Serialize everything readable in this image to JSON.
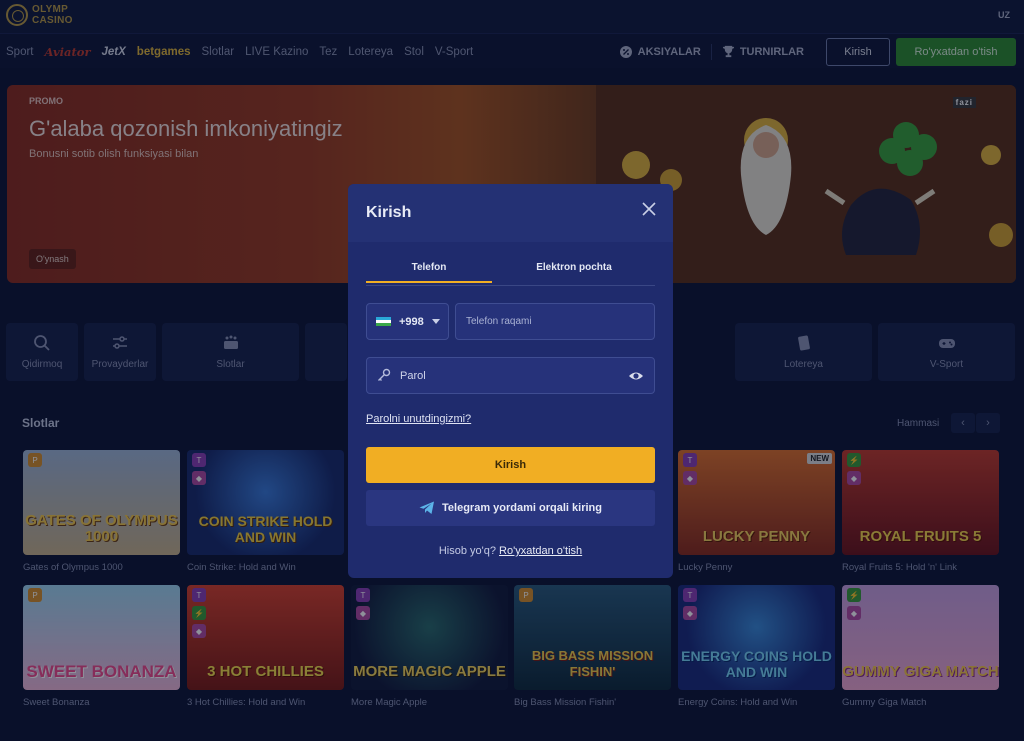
{
  "header": {
    "logo_line1": "OLYMP",
    "logo_line2": "CASINO",
    "lang": "UZ"
  },
  "nav": {
    "links": [
      "Sport",
      "Aviator",
      "JetX",
      "betgames",
      "Slotlar",
      "LIVE Kazino",
      "Tez",
      "Lotereya",
      "Stol",
      "V-Sport"
    ],
    "promotions": "AKSIYALAR",
    "tournaments": "TURNIRLAR",
    "login": "Kirish",
    "register": "Ro'yxatdan o'tish"
  },
  "banner": {
    "tag": "PROMO",
    "title": "G'alaba qozonish imkoniyatingiz",
    "subtitle": "Bonusni sotib olish funksiyasi bilan",
    "cta": "O'ynash",
    "provider": "fazi"
  },
  "categories": [
    "Qidirmoq",
    "Provayderlar",
    "Slotlar",
    "Lotereya",
    "V-Sport"
  ],
  "slots": {
    "title": "Slotlar",
    "all": "Hammasi",
    "games_row1": [
      {
        "name": "Gates of Olympus 1000",
        "art": "GATES OF OLYMPUS 1000"
      },
      {
        "name": "Coin Strike: Hold and Win",
        "art": "COIN STRIKE HOLD AND WIN"
      },
      {
        "name": "Lucky Penny",
        "art": "LUCKY PENNY"
      },
      {
        "name": "Royal Fruits 5: Hold 'n' Link",
        "art": "ROYAL FRUITS 5"
      }
    ],
    "games_row2": [
      {
        "name": "Sweet Bonanza",
        "art": "SWEET BONANZA"
      },
      {
        "name": "3 Hot Chillies: Hold and Win",
        "art": "3 HOT CHILLIES"
      },
      {
        "name": "More Magic Apple",
        "art": "MORE MAGIC APPLE"
      },
      {
        "name": "Big Bass Mission Fishin'",
        "art": "BIG BASS MISSION FISHIN'"
      },
      {
        "name": "Energy Coins: Hold and Win",
        "art": "ENERGY COINS HOLD AND WIN"
      },
      {
        "name": "Gummy Giga Match",
        "art": "GUMMY GIGA MATCH"
      }
    ],
    "new_badge": "NEW"
  },
  "modal": {
    "title": "Kirish",
    "tab_phone": "Telefon",
    "tab_email": "Elektron pochta",
    "country_code": "+998",
    "phone_placeholder": "Telefon raqami",
    "password_placeholder": "Parol",
    "forgot": "Parolni unutdingizmi?",
    "submit": "Kirish",
    "telegram": "Telegram yordami orqali kiring",
    "no_account": "Hisob yo'q?",
    "register_link": "Ro'yxatdan o'tish"
  },
  "colors": {
    "accent": "#f1ae23",
    "register": "#2f8a2f",
    "modal_bg": "#1f2b6d"
  }
}
